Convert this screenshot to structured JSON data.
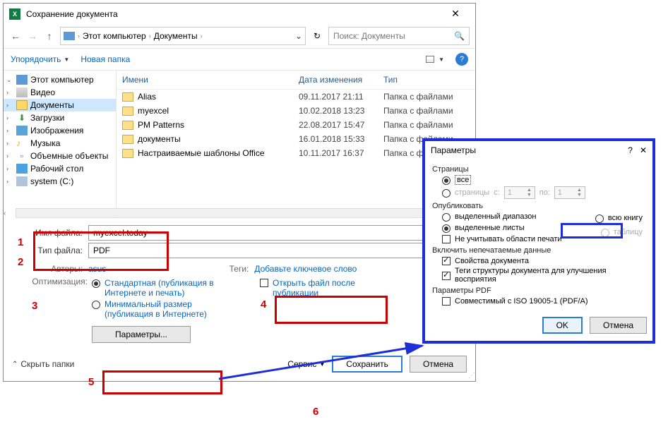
{
  "dialog": {
    "title": "Сохранение документа",
    "back": "←",
    "fwd": "→",
    "up": "↑",
    "crumbs": {
      "root": "Этот компьютер",
      "folder": "Документы"
    },
    "search_placeholder": "Поиск: Документы",
    "toolbar": {
      "organize": "Упорядочить",
      "new_folder": "Новая папка"
    }
  },
  "tree": {
    "this_pc": "Этот компьютер",
    "video": "Видео",
    "documents": "Документы",
    "downloads": "Загрузки",
    "pictures": "Изображения",
    "music": "Музыка",
    "objects3d": "Объемные объекты",
    "desktop": "Рабочий стол",
    "drive_c": "system (C:)"
  },
  "columns": {
    "name": "Имени",
    "date": "Дата изменения",
    "type": "Тип"
  },
  "files": [
    {
      "name": "Alias",
      "date": "09.11.2017 21:11",
      "type": "Папка с файлами"
    },
    {
      "name": "myexcel",
      "date": "10.02.2018 13:23",
      "type": "Папка с файлами"
    },
    {
      "name": "PM Patterns",
      "date": "22.08.2017 15:47",
      "type": "Папка с файлами"
    },
    {
      "name": "документы",
      "date": "16.01.2018 15:33",
      "type": "Папка с файлами"
    },
    {
      "name": "Настраиваемые шаблоны Office",
      "date": "10.11.2017 16:37",
      "type": "Папка с файлами"
    }
  ],
  "form": {
    "filename_label": "Имя файла:",
    "filename_value": "myexcel.today",
    "filetype_label": "Тип файла:",
    "filetype_value": "PDF",
    "authors_label": "Авторы:",
    "authors_value": "asus",
    "tags_label": "Теги:",
    "tags_value": "Добавьте ключевое слово",
    "optimize_label": "Оптимизация:",
    "opt_standard": "Стандартная (публикация в Интернете и печать)",
    "opt_minimal": "Минимальный размер (публикация в Интернете)",
    "open_after": "Открыть файл после публикации",
    "options_btn": "Параметры...",
    "hide_folders": "Скрыть папки",
    "service": "Сервис",
    "save": "Сохранить",
    "cancel": "Отмена"
  },
  "callouts": {
    "n1": "1",
    "n2": "2",
    "n3": "3",
    "n4": "4",
    "n5": "5",
    "n6": "6"
  },
  "param": {
    "title": "Параметры",
    "pages": "Страницы",
    "all": "все",
    "pages_range": "страницы",
    "from": "с:",
    "to": "по:",
    "spin_val": "1",
    "publish": "Опубликовать",
    "sel_range": "выделенный диапазон",
    "whole_book": "всю книгу",
    "sel_sheets": "выделенные листы",
    "table": "таблицу",
    "ignore_print_areas": "Не учитывать области печати",
    "include_nonprint": "Включить непечатаемые данные",
    "doc_props": "Свойства документа",
    "doc_struct": "Теги структуры документа для улучшения восприятия",
    "pdf_params": "Параметры PDF",
    "iso": "Совместимый с ISO 19005-1 (PDF/A)",
    "ok": "OK",
    "cancel": "Отмена"
  }
}
